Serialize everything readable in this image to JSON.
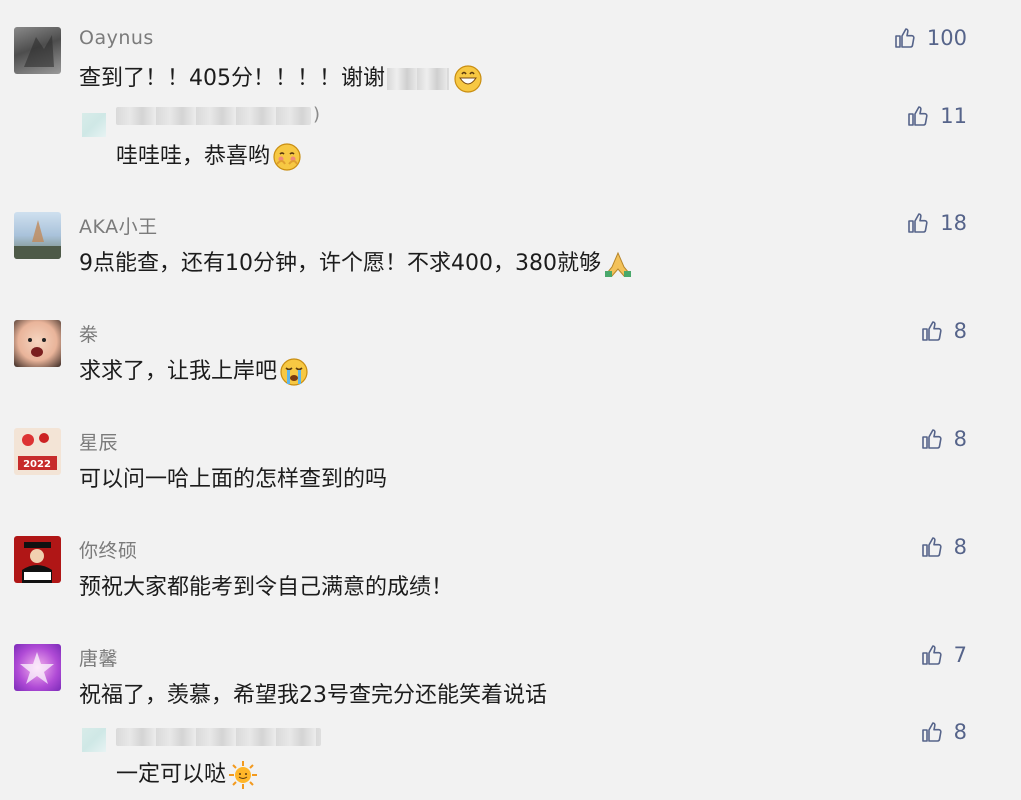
{
  "comments": [
    {
      "name": "Oaynus",
      "text_before": "查到了！！405分！！！！谢谢",
      "text_after": "",
      "likes": "100",
      "reply": {
        "name_suffix": ")",
        "text": "哇哇哇，恭喜哟",
        "likes": "11"
      }
    },
    {
      "name": "AKA小王",
      "text": "9点能查，还有10分钟，许个愿！不求400，380就够",
      "likes": "18"
    },
    {
      "name": "桊",
      "text": "求求了，让我上岸吧",
      "likes": "8"
    },
    {
      "name": "星辰",
      "text": "可以问一哈上面的怎样查到的吗",
      "likes": "8"
    },
    {
      "name": "你终硕",
      "text": "预祝大家都能考到令自己满意的成绩！",
      "likes": "8"
    },
    {
      "name": "唐馨",
      "text": "祝福了，羡慕，希望我23号查完分还能笑着说话",
      "likes": "7",
      "reply": {
        "text": "一定可以哒",
        "likes": "8"
      }
    }
  ],
  "icons": {
    "like": "thumbs-up-icon",
    "like_color": "#56648a"
  }
}
